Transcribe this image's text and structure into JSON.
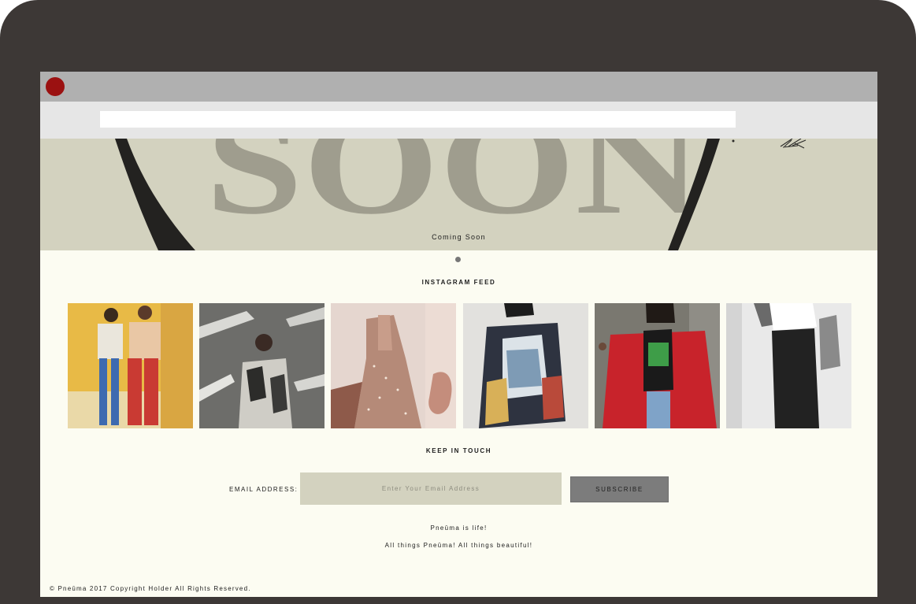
{
  "browser": {
    "address_value": ""
  },
  "hero": {
    "big_word": "SOON",
    "subtitle": "Coming Soon"
  },
  "instagram": {
    "title": "INSTAGRAM FEED",
    "posts": [
      {
        "label": "instagram-post-1"
      },
      {
        "label": "instagram-post-2"
      },
      {
        "label": "instagram-post-3"
      },
      {
        "label": "instagram-post-4"
      },
      {
        "label": "instagram-post-5"
      },
      {
        "label": "instagram-post-6"
      }
    ]
  },
  "newsletter": {
    "title": "KEEP IN TOUCH",
    "email_label": "EMAIL ADDRESS:",
    "email_placeholder": "Enter Your Email Address",
    "email_value": "",
    "subscribe_label": "SUBSCRIBE"
  },
  "taglines": {
    "line1": "Pneūma is life!",
    "line2": "All things Pneūma! All things beautiful!"
  },
  "footer": {
    "copyright": "© Pneūma 2017 Copyright Holder All Rights Reserved."
  },
  "colors": {
    "bezel": "#3d3836",
    "page_background": "#fcfcf2",
    "hero_background": "#d3d2bf",
    "close_button": "#9b1111",
    "subscribe_button": "#7c7c7c"
  },
  "icons": [
    "close-window-icon",
    "slider-dot-icon"
  ]
}
